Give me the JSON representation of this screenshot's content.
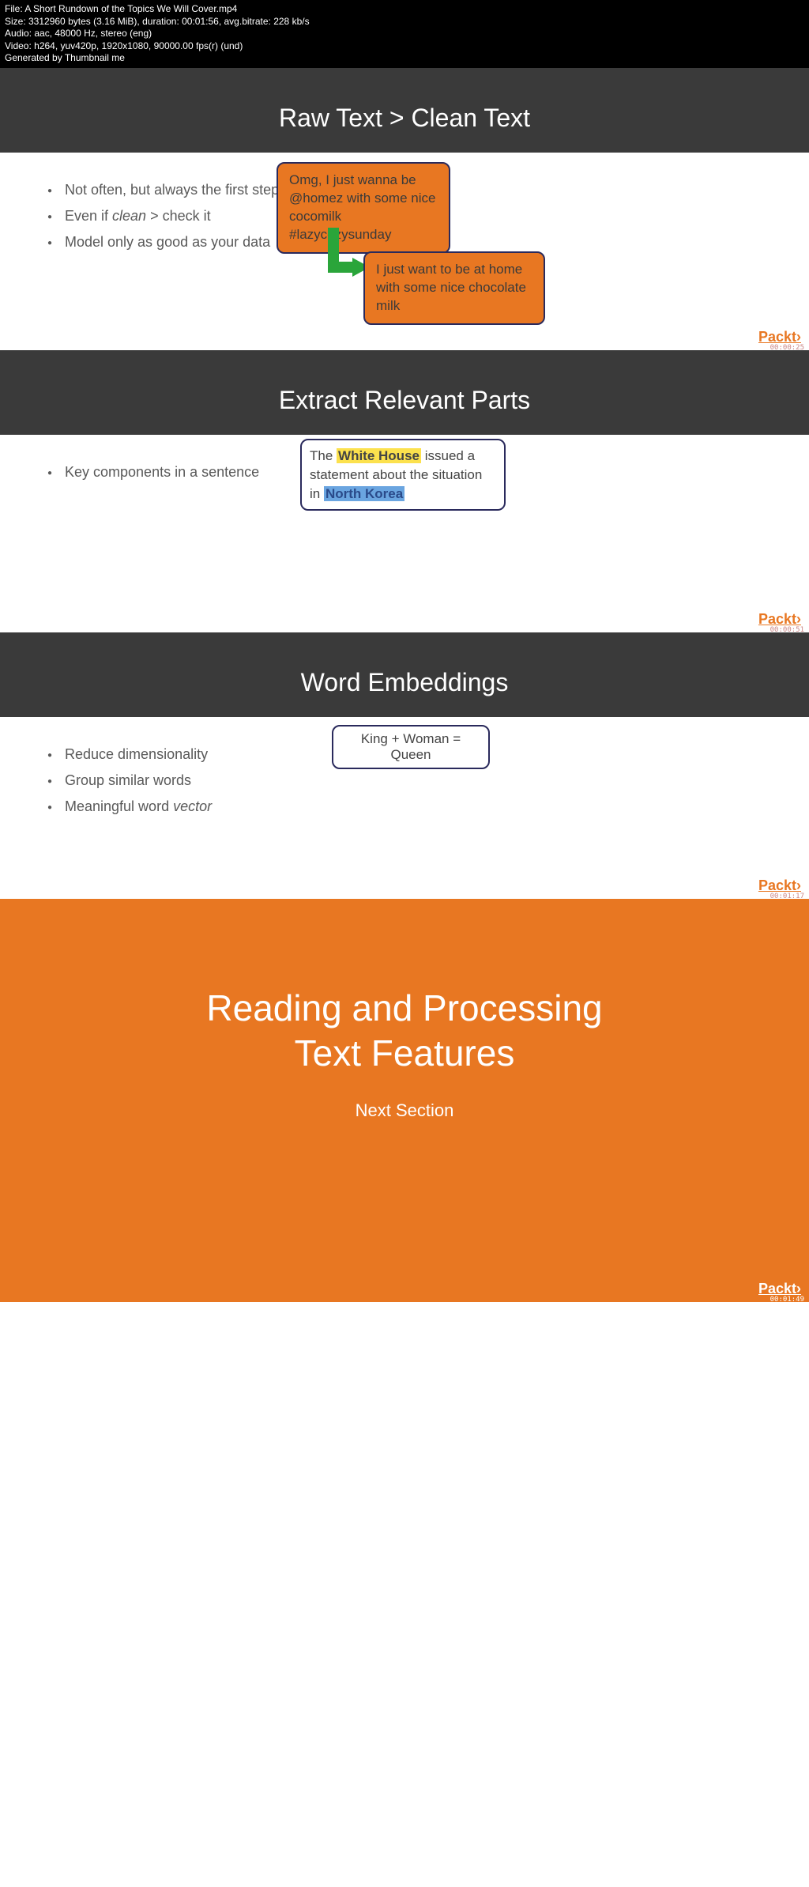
{
  "meta": {
    "file": "File: A Short Rundown of the Topics We Will Cover.mp4",
    "size": "Size: 3312960 bytes (3.16 MiB), duration: 00:01:56, avg.bitrate: 228 kb/s",
    "audio": "Audio: aac, 48000 Hz, stereo (eng)",
    "video": "Video: h264, yuv420p, 1920x1080, 90000.00 fps(r) (und)",
    "gen": "Generated by Thumbnail me"
  },
  "packt": "Packt›",
  "slides": [
    {
      "title": "Raw Text > Clean Text",
      "bullets": {
        "b1a": "Not often, but always the first step",
        "b2a": "Even if ",
        "b2i": "clean",
        "b2b": " > check it",
        "b3a": "Model only as good as your data"
      },
      "bubble1": "Omg, I just wanna be @homez with some nice cocomilk #lazycozysunday",
      "bubble2": "I just want to be at home with some nice chocolate milk",
      "ts": "00:00:25"
    },
    {
      "title": "Extract Relevant Parts",
      "bullets": {
        "b1": "Key components in a sentence"
      },
      "entity": {
        "t1": "The ",
        "e1": "White House",
        "t2": " issued a statement about the situation in ",
        "e2": "North Korea"
      },
      "ts": "00:00:51"
    },
    {
      "title": "Word Embeddings",
      "bullets": {
        "b1": "Reduce dimensionality",
        "b2": "Group similar words",
        "b3a": "Meaningful word ",
        "b3i": "vector"
      },
      "equation": "King + Woman = Queen",
      "ts": "00:01:17"
    }
  ],
  "final": {
    "title_l1": "Reading and Processing",
    "title_l2": "Text Features",
    "subtitle": "Next Section",
    "ts": "00:01:49"
  }
}
